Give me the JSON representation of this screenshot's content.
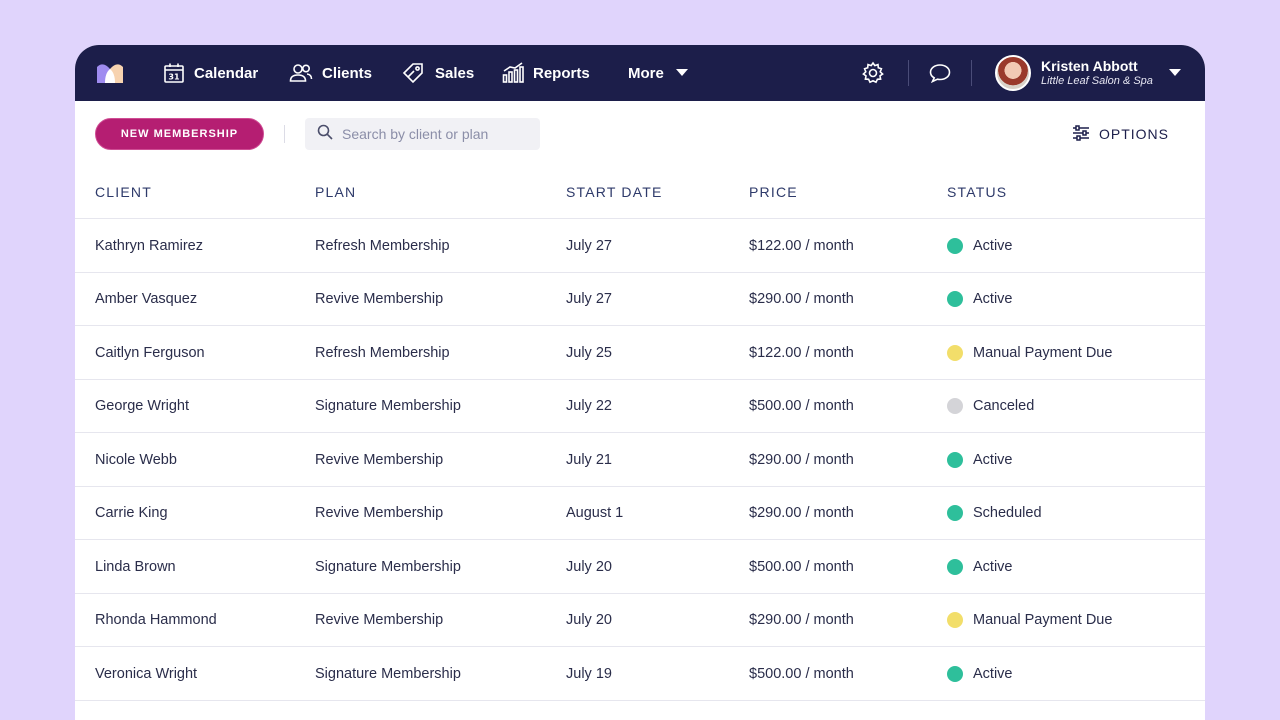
{
  "nav": {
    "items": [
      {
        "label": "Calendar",
        "icon": "calendar-icon"
      },
      {
        "label": "Clients",
        "icon": "clients-icon"
      },
      {
        "label": "Sales",
        "icon": "tag-icon"
      },
      {
        "label": "Reports",
        "icon": "chart-icon"
      }
    ],
    "more_label": "More",
    "user": {
      "name": "Kristen Abbott",
      "business": "Little Leaf Salon & Spa"
    }
  },
  "toolbar": {
    "new_button": "NEW MEMBERSHIP",
    "search_placeholder": "Search by client or plan",
    "options_label": "OPTIONS"
  },
  "table": {
    "columns": [
      "CLIENT",
      "PLAN",
      "START DATE",
      "PRICE",
      "STATUS"
    ],
    "rows": [
      {
        "client": "Kathryn Ramirez",
        "plan": "Refresh Membership",
        "start": "July 27",
        "price": "$122.00 / month",
        "status": "Active",
        "status_color": "#2ebf9b"
      },
      {
        "client": "Amber Vasquez",
        "plan": "Revive Membership",
        "start": "July 27",
        "price": "$290.00 / month",
        "status": "Active",
        "status_color": "#2ebf9b"
      },
      {
        "client": "Caitlyn Ferguson",
        "plan": "Refresh Membership",
        "start": "July 25",
        "price": "$122.00 / month",
        "status": "Manual Payment Due",
        "status_color": "#f2de6a"
      },
      {
        "client": "George Wright",
        "plan": "Signature Membership",
        "start": "July 22",
        "price": "$500.00 / month",
        "status": "Canceled",
        "status_color": "#d4d4d8"
      },
      {
        "client": "Nicole Webb",
        "plan": "Revive Membership",
        "start": "July 21",
        "price": "$290.00 / month",
        "status": "Active",
        "status_color": "#2ebf9b"
      },
      {
        "client": "Carrie King",
        "plan": "Revive Membership",
        "start": "August 1",
        "price": "$290.00 / month",
        "status": "Scheduled",
        "status_color": "#2ebf9b"
      },
      {
        "client": "Linda Brown",
        "plan": "Signature Membership",
        "start": "July 20",
        "price": "$500.00 / month",
        "status": "Active",
        "status_color": "#2ebf9b"
      },
      {
        "client": "Rhonda Hammond",
        "plan": "Revive Membership",
        "start": "July 20",
        "price": "$290.00 / month",
        "status": "Manual Payment Due",
        "status_color": "#f2de6a"
      },
      {
        "client": "Veronica Wright",
        "plan": "Signature Membership",
        "start": "July 19",
        "price": "$500.00 / month",
        "status": "Active",
        "status_color": "#2ebf9b"
      }
    ]
  },
  "colors": {
    "nav_bg": "#1c1e4a",
    "primary_button": "#b51e72",
    "page_bg": "#e0d4fc"
  }
}
